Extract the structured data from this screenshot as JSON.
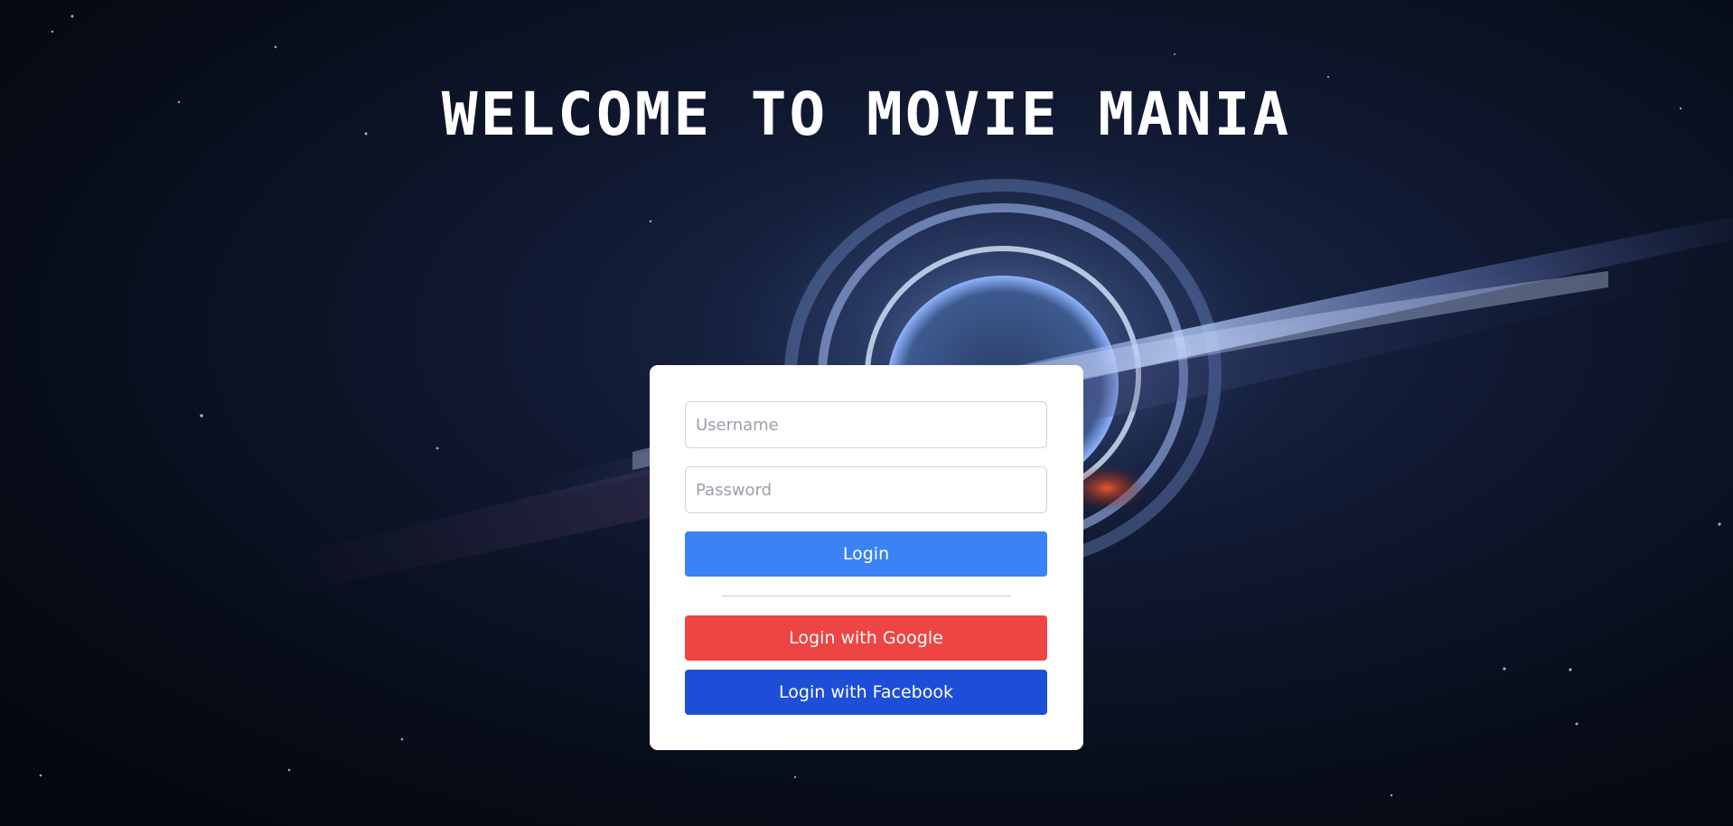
{
  "page": {
    "title": "WELCOME TO MOVIE MANIA"
  },
  "login_form": {
    "username_placeholder": "Username",
    "username_value": "",
    "password_placeholder": "Password",
    "password_value": "",
    "login_label": "Login",
    "google_label": "Login with Google",
    "facebook_label": "Login with Facebook"
  },
  "colors": {
    "login_button": "#3b82f6",
    "google_button": "#ef4444",
    "facebook_button": "#1d4ed8",
    "card": "#ffffff",
    "background": "#0a0f1c"
  }
}
